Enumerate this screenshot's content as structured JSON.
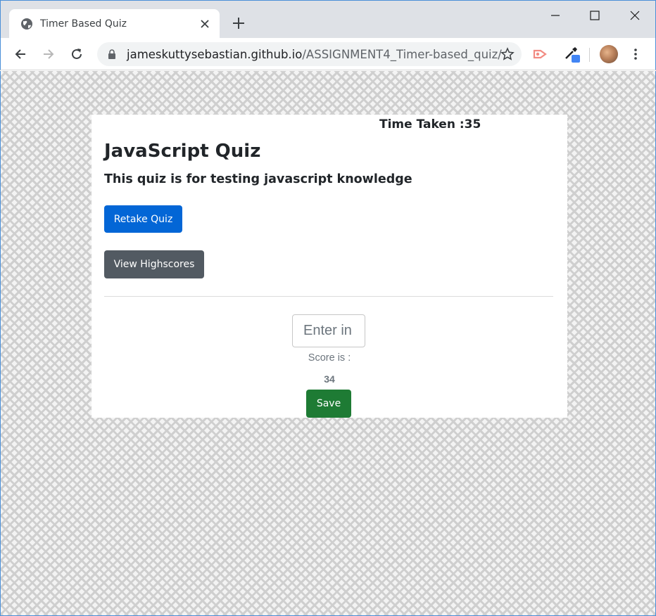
{
  "browser": {
    "tab_title": "Timer Based Quiz",
    "url_host": "jameskuttysebastian.github.io",
    "url_path": "/ASSIGNMENT4_Timer-based_quiz/"
  },
  "page": {
    "timer_text": "Time Taken :35",
    "title": "JavaScript Quiz",
    "subtitle": "This quiz is for testing javascript knowledge",
    "retake_label": "Retake Quiz",
    "highscores_label": "View Highscores",
    "initials_placeholder": "Enter in",
    "score_label": "Score is :",
    "score_value": "34",
    "save_label": "Save"
  },
  "colors": {
    "primary": "#0366d6",
    "secondary": "#525a62",
    "success": "#1e7b34"
  },
  "icons": {
    "favicon": "globe-icon",
    "tab_close": "close-icon",
    "new_tab": "plus-icon",
    "back": "back-arrow-icon",
    "forward": "forward-arrow-icon",
    "reload": "reload-icon",
    "lock": "lock-icon",
    "bookmark": "star-icon",
    "ext1": "cast-extension-icon",
    "ext2": "eyedropper-extension-icon",
    "menu": "kebab-menu-icon"
  }
}
